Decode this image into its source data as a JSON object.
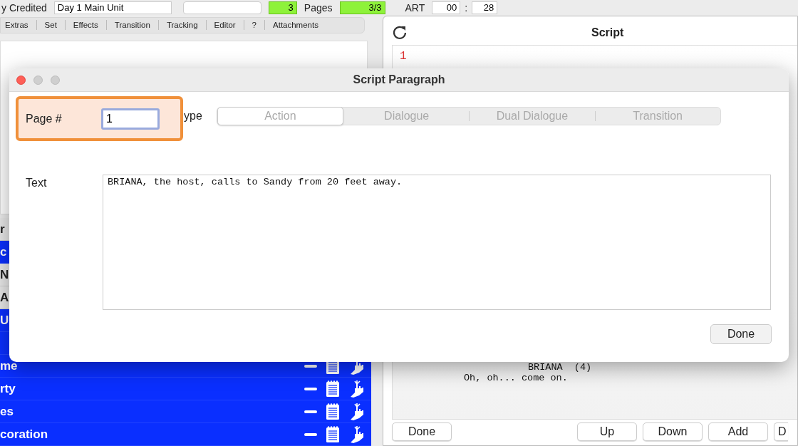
{
  "top_bar": {
    "credited_label": "y Credited",
    "unit_value": "Day 1 Main Unit",
    "count_value": "3",
    "pages_label": "Pages",
    "pages_value": "3/3",
    "art_label": "ART",
    "art_minutes": "00",
    "art_separator": ":",
    "art_seconds": "28"
  },
  "tabs": [
    {
      "label": "Extras",
      "selected": false
    },
    {
      "label": "Set",
      "selected": false
    },
    {
      "label": "Effects",
      "selected": false
    },
    {
      "label": "Transition",
      "selected": false
    },
    {
      "label": "Tracking",
      "selected": false
    },
    {
      "label": "Editor",
      "selected": false
    },
    {
      "label": "?",
      "selected": false
    },
    {
      "label": "Attachments",
      "selected": false
    }
  ],
  "list_rows": [
    {
      "label": "r",
      "selected": false
    },
    {
      "label": "c",
      "selected": true
    },
    {
      "label": "N",
      "selected": false
    },
    {
      "label": "A",
      "selected": false
    },
    {
      "label": "U",
      "selected": true
    },
    {
      "selected": true
    },
    {
      "label": "me",
      "selected": true,
      "tools": true
    },
    {
      "label": "rty",
      "selected": true,
      "tools": true
    },
    {
      "label": "es",
      "selected": true,
      "tools": true
    },
    {
      "label": "coration",
      "selected": true,
      "tools": true
    }
  ],
  "script_panel": {
    "title": "Script",
    "page_number": "1",
    "character": "BRIANA  (4)",
    "dialogue": "Oh, oh... come on.",
    "buttons": [
      "Done",
      "Up",
      "Down",
      "Add",
      "D"
    ]
  },
  "dialog": {
    "title": "Script Paragraph",
    "page_label": "Page #",
    "page_value": "1",
    "type_label": "ype",
    "type_options": [
      {
        "label": "Action",
        "selected": true
      },
      {
        "label": "Dialogue",
        "selected": false
      },
      {
        "label": "Dual Dialogue",
        "selected": false
      },
      {
        "label": "Transition",
        "selected": false
      }
    ],
    "text_label": "Text",
    "text_value": "BRIANA, the host, calls to Sandy from 20 feet away.",
    "done_button": "Done"
  }
}
